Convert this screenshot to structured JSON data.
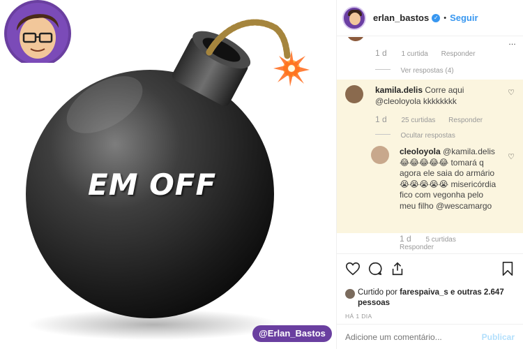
{
  "image": {
    "caption": "EM OFF",
    "watermark": "@Erlan_Bastos"
  },
  "header": {
    "username": "erlan_bastos",
    "separator": "•",
    "follow_label": "Seguir"
  },
  "comments": {
    "prev": {
      "time": "1 d",
      "likes": "1 curtida",
      "reply": "Responder",
      "view_replies": "Ver respostas (4)"
    },
    "main": {
      "username": "kamila.delis",
      "text": "Corre aqui @cleoloyola kkkkkkkk",
      "time": "1 d",
      "likes": "25 curtidas",
      "reply": "Responder",
      "hide_replies": "Ocultar respostas"
    },
    "reply": {
      "username": "cleoloyola",
      "text_a": "@kamila.delis 😂😂😂😂😂 tomará q agora ele saia do armário 😭😭😭😭😭",
      "text_b": "misericórdia fico com vegonha pelo meu filho @wescamargo",
      "time": "1 d",
      "likes": "5 curtidas",
      "reply": "Responder"
    }
  },
  "likes": {
    "prefix": "Curtido por",
    "user": "farespaiva_s",
    "suffix": "e outras 2.647 pessoas"
  },
  "post_age": "HÁ 1 DIA",
  "comment_input": {
    "placeholder": "Adicione um comentário...",
    "publish_label": "Publicar"
  },
  "colors": {
    "accent": "#3897f0",
    "highlight": "#fbf5df",
    "watermark": "#6a3fa0"
  }
}
